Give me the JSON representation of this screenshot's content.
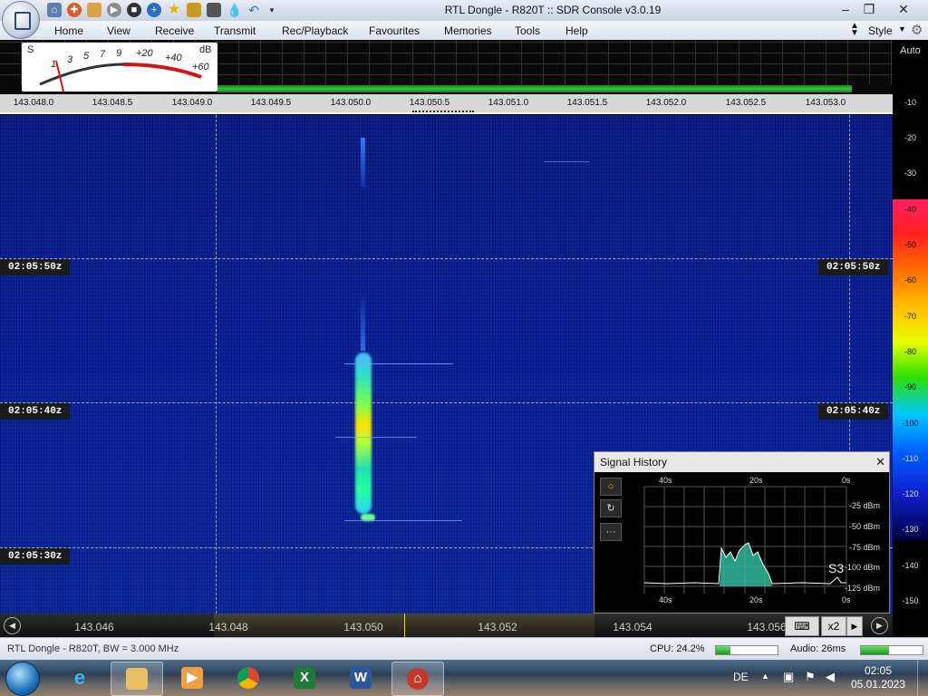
{
  "window": {
    "title": "RTL Dongle - R820T :: SDR Console v3.0.19"
  },
  "menu": {
    "items": [
      "Home",
      "View",
      "Receive",
      "Transmit",
      "Rec/Playback",
      "Favourites",
      "Memories",
      "Tools",
      "Help"
    ],
    "style_label": "Style"
  },
  "meter": {
    "s_label": "S",
    "db_label": "dB",
    "scale": [
      "1",
      "3",
      "5",
      "7",
      "9",
      "+20",
      "+40",
      "+60"
    ]
  },
  "frequency_scale": {
    "ticks": [
      "143.048.0",
      "143.048.5",
      "143.049.0",
      "143.049.5",
      "143.050.0",
      "143.050.5",
      "143.051.0",
      "143.051.5",
      "143.052.0",
      "143.052.5",
      "143.053.0"
    ]
  },
  "waterfall": {
    "timestamps": [
      "02:05:50z",
      "02:05:40z",
      "02:05:30z"
    ]
  },
  "db_scale": {
    "auto_label": "Auto",
    "labels": [
      "-10",
      "-20",
      "-30",
      "-40",
      "-50",
      "-60",
      "-70",
      "-80",
      "-90",
      "-100",
      "-110",
      "-120",
      "-130",
      "-140",
      "-150"
    ]
  },
  "signal_history": {
    "title": "Signal History",
    "close": "✕",
    "time_labels": [
      "40s",
      "20s",
      "0s"
    ],
    "level_labels": [
      "-25 dBm",
      "-50 dBm",
      "-75 dBm",
      "-100 dBm",
      "-125 dBm"
    ],
    "s_reading": "S3",
    "buttons": [
      "○",
      "↻",
      "···"
    ]
  },
  "bottom_scale": {
    "ticks": [
      "143.046",
      "143.048",
      "143.050",
      "143.052",
      "143.054",
      "143.056"
    ],
    "zoom": "x2"
  },
  "status": {
    "device": "RTL Dongle - R820T, BW = 3.000 MHz",
    "cpu_label": "CPU: 24.2%",
    "cpu_value": 0.242,
    "audio_label": "Audio: 26ms",
    "audio_value": 0.45
  },
  "taskbar": {
    "language": "DE",
    "time": "02:05",
    "date": "05.01.2023"
  },
  "colors": {
    "waterfall_bg": "#0b2196",
    "accent_green": "#39c43c",
    "signal_yellow": "#ffd700"
  }
}
